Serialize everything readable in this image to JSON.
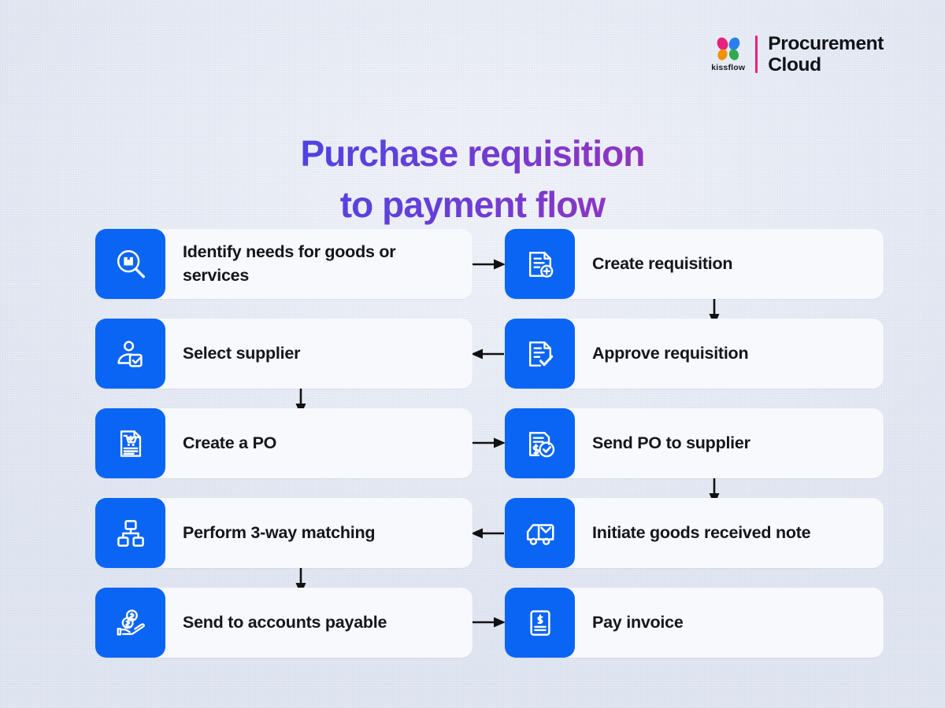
{
  "brand": {
    "logo_name": "kissflow-butterfly-logo",
    "wordmark": "kissflow",
    "product_line1": "Procurement",
    "product_line2": "Cloud",
    "colors": {
      "petal_pink": "#e6217d",
      "petal_blue": "#2b7ef0",
      "petal_orange": "#f29100",
      "petal_green": "#33a852",
      "divider": "#e6217d"
    }
  },
  "title": {
    "line1": "Purchase requisition",
    "line2": "to payment flow",
    "gradient_from": "#2b50f0",
    "gradient_to": "#c2219c"
  },
  "theme": {
    "background": "#e6eaf5",
    "card_background": "#f8f9fd",
    "icon_tile": "#0a65f5",
    "text": "#14161a",
    "arrow": "#111111"
  },
  "flow": {
    "rows": [
      {
        "left": {
          "label": "Identify needs for goods or services",
          "icon": "package-search-icon"
        },
        "right": {
          "label": "Create requisition",
          "icon": "document-plus-icon"
        },
        "connector_horizontal": "right",
        "connector_vertical": "right-down"
      },
      {
        "left": {
          "label": "Select supplier",
          "icon": "supplier-check-icon"
        },
        "right": {
          "label": "Approve requisition",
          "icon": "document-check-icon"
        },
        "connector_horizontal": "left",
        "connector_vertical": "left-down"
      },
      {
        "left": {
          "label": "Create a PO",
          "icon": "document-cart-icon"
        },
        "right": {
          "label": "Send PO to supplier",
          "icon": "invoice-approved-icon"
        },
        "connector_horizontal": "right",
        "connector_vertical": "right-down"
      },
      {
        "left": {
          "label": "Perform 3-way matching",
          "icon": "three-way-match-icon"
        },
        "right": {
          "label": "Initiate goods received note",
          "icon": "delivery-truck-icon"
        },
        "connector_horizontal": "left",
        "connector_vertical": "left-down"
      },
      {
        "left": {
          "label": "Send to accounts payable",
          "icon": "hand-coins-icon"
        },
        "right": {
          "label": "Pay invoice",
          "icon": "invoice-dollar-icon"
        },
        "connector_horizontal": "right",
        "connector_vertical": "none"
      }
    ]
  }
}
